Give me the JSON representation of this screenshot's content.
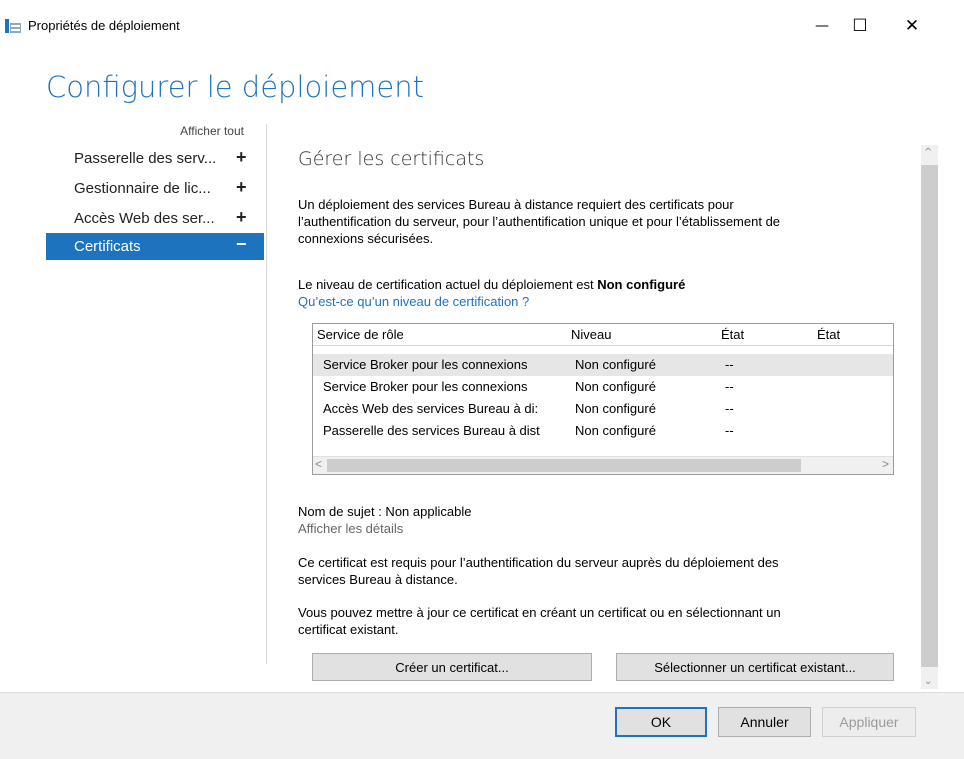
{
  "window": {
    "title": "Propriétés de déploiement",
    "controls": {
      "minimize": "—",
      "maximize": "☐",
      "close": "✕"
    }
  },
  "heading": "Configurer le déploiement",
  "nav": {
    "show_all": "Afficher tout",
    "items": [
      {
        "label": "Passerelle des serv...",
        "symbol": "+"
      },
      {
        "label": "Gestionnaire de lic...",
        "symbol": "+"
      },
      {
        "label": "Accès Web des ser...",
        "symbol": "+"
      },
      {
        "label": "Certificats",
        "symbol": "−"
      }
    ]
  },
  "content": {
    "section_title": "Gérer les certificats",
    "intro_line1": "Un déploiement des services Bureau à distance requiert des certificats pour",
    "intro_line2": "l’authentification du serveur, pour l’authentification unique et pour l’établissement de",
    "intro_line3": "connexions sécurisées.",
    "level_prefix": "Le niveau de certification actuel du déploiement est ",
    "level_value": "Non configuré",
    "level_link": "Qu’est-ce qu’un niveau de certification ?",
    "table": {
      "headers": [
        "Service de rôle",
        "Niveau",
        "État",
        "État"
      ],
      "rows": [
        {
          "service": "Service Broker pour les connexions",
          "level": "Non configuré",
          "state": "--"
        },
        {
          "service": "Service Broker pour les connexions",
          "level": "Non configuré",
          "state": "--"
        },
        {
          "service": "Accès Web des services Bureau à di:",
          "level": "Non configuré",
          "state": "--"
        },
        {
          "service": "Passerelle des services Bureau à dist",
          "level": "Non configuré",
          "state": "--"
        }
      ],
      "scroll_left": "<",
      "scroll_right": ">"
    },
    "subject_name": "Nom de sujet : Non applicable",
    "show_details": "Afficher les détails",
    "required_line1": "Ce certificat est requis pour l’authentification du serveur auprès du déploiement des",
    "required_line2": "services Bureau à distance.",
    "update_line1": "Vous pouvez mettre à jour ce certificat en créant un certificat ou en sélectionnant un",
    "update_line2": "certificat existant.",
    "create_button": "Créer un certificat...",
    "select_button": "Sélectionner un certificat existant..."
  },
  "scrollbar": {
    "up": "^",
    "down": "⌄"
  },
  "footer": {
    "ok": "OK",
    "cancel": "Annuler",
    "apply": "Appliquer"
  },
  "colors": {
    "accent": "#1e73be",
    "selection": "#e6e6e6",
    "footer_bg": "#f0f0f0"
  }
}
